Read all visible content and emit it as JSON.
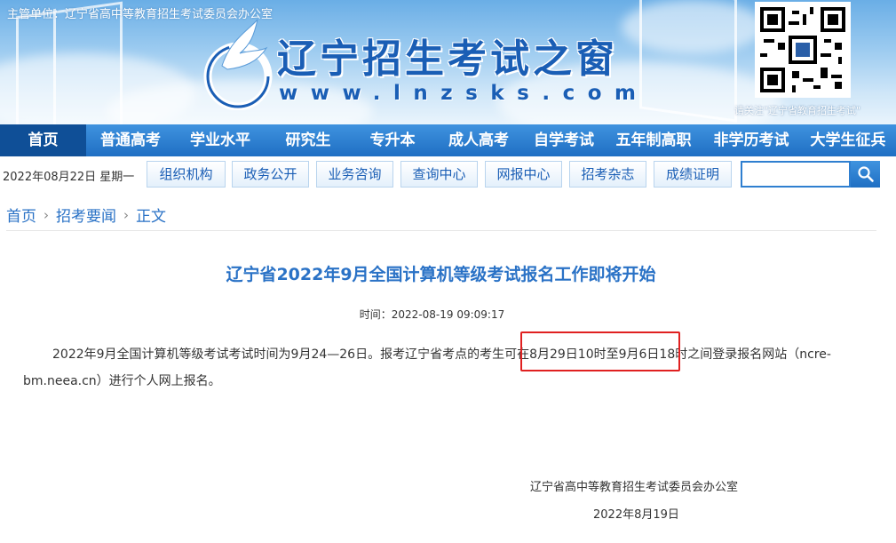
{
  "header": {
    "sponsor": "主管单位：辽宁省高中等教育招生考试委员会办公室",
    "site_name": "辽宁招生考试之窗",
    "site_url": "www.lnzsks.com",
    "qr_caption": "请关注\"辽宁省教育招生考试\""
  },
  "main_nav": [
    {
      "label": "首页",
      "active": true
    },
    {
      "label": "普通高考"
    },
    {
      "label": "学业水平"
    },
    {
      "label": "研究生"
    },
    {
      "label": "专升本"
    },
    {
      "label": "成人高考"
    },
    {
      "label": "自学考试"
    },
    {
      "label": "五年制高职"
    },
    {
      "label": "非学历考试"
    },
    {
      "label": "大学生征兵"
    }
  ],
  "sub_nav": {
    "date": "2022年08月22日 星期一",
    "items": [
      "组织机构",
      "政务公开",
      "业务咨询",
      "查询中心",
      "网报中心",
      "招考杂志",
      "成绩证明"
    ],
    "search_value": ""
  },
  "breadcrumb": [
    "首页",
    "招考要闻",
    "正文"
  ],
  "article": {
    "title": "辽宁省2022年9月全国计算机等级考试报名工作即将开始",
    "time": "时间：2022-08-19 09:09:17",
    "body": "2022年9月全国计算机等级考试考试时间为9月24—26日。报考辽宁省考点的考生可在8月29日10时至9月6日18时之间登录报名网站（ncre-bm.neea.cn）进行个人网上报名。",
    "signature": "辽宁省高中等教育招生考试委员会办公室",
    "sign_date": "2022年8月19日"
  },
  "colors": {
    "nav_blue": "#2f7fd0",
    "title_blue": "#2a72c6",
    "highlight_red": "#e02020"
  },
  "icons": [
    "dove-logo-icon",
    "qr-code-icon",
    "search-icon"
  ]
}
